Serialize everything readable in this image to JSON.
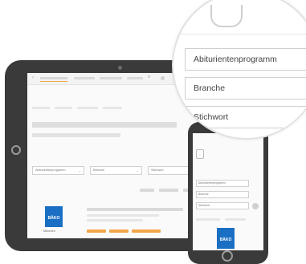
{
  "magnifier": {
    "field_1": "Abiturientenprogramm",
    "field_2": "Branche",
    "field_3": "Stichwort"
  },
  "tablet": {
    "select_1": "Abiturientenprogramm",
    "select_2": "Branche",
    "select_3": "Stichwort",
    "logo_text": "BÄKO",
    "logo_caption": "München"
  },
  "phone": {
    "select_1": "Abiturientenprogramm",
    "select_2": "Branche",
    "select_3": "Stichwort",
    "logo_text": "BÄKO"
  },
  "colors": {
    "brand_blue": "#1a6fc4",
    "tag_orange": "#f2a64a",
    "device": "#3a3a3a"
  }
}
